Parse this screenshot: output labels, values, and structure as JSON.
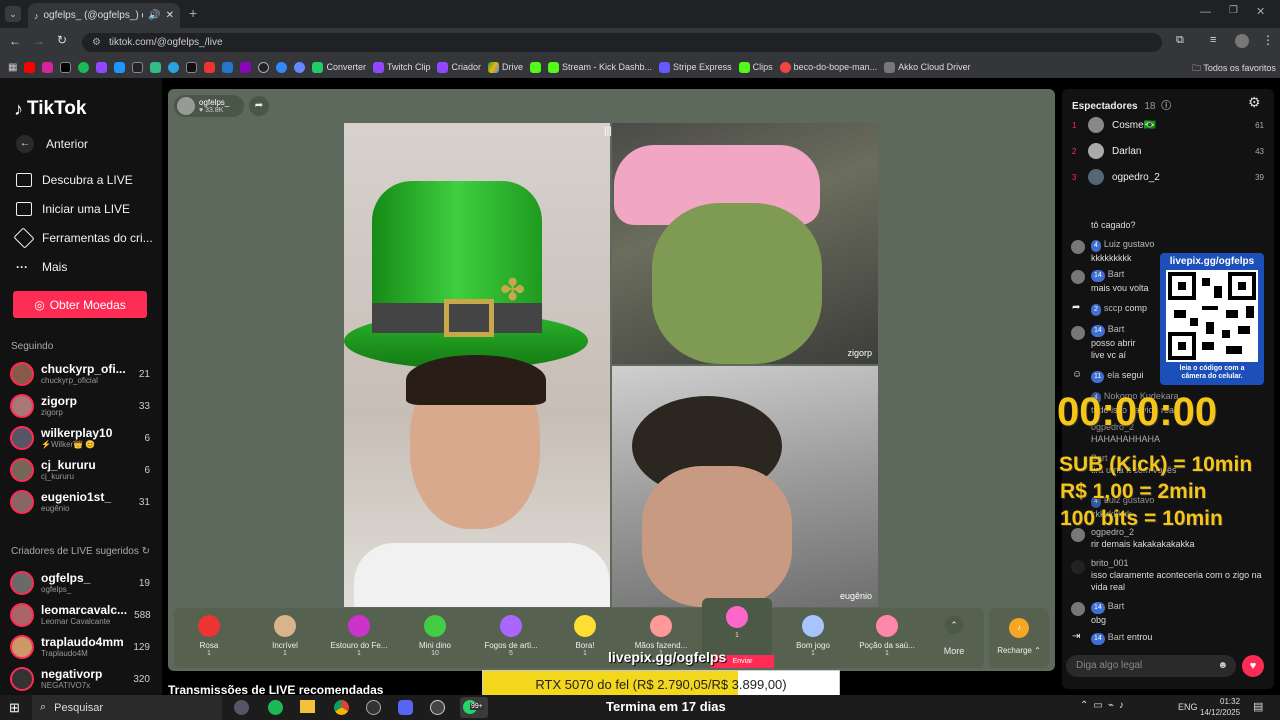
{
  "browser": {
    "tab_title": "ogfelps_ (@ogfelps_) come...",
    "url": "tiktok.com/@ogfelps_/live",
    "bookmarks": [
      "Converter",
      "Twitch Clip",
      "Criador",
      "Drive",
      "Stream - Kick Dashb...",
      "Stripe Express",
      "Clips",
      "beco-do-bope-man...",
      "Akko Cloud Driver"
    ],
    "all_favorites": "Todos os favoritos"
  },
  "sidebar": {
    "logo": "TikTok",
    "back": "Anterior",
    "nav": [
      "Descubra a LIVE",
      "Iniciar uma LIVE",
      "Ferramentas do cri...",
      "Mais"
    ],
    "coins_button": "Obter Moedas",
    "following_header": "Seguindo",
    "following": [
      {
        "name": "chuckyrp_ofi...",
        "sub": "chuckyrp_oficial",
        "count": "21"
      },
      {
        "name": "zigorp",
        "sub": "zigorp",
        "count": "33"
      },
      {
        "name": "wilkerplay10",
        "sub": "⚡Wilker👑 😊",
        "count": "6"
      },
      {
        "name": "cj_kururu",
        "sub": "cj_kururu",
        "count": "6"
      },
      {
        "name": "eugenio1st_",
        "sub": "eugênio",
        "count": "31"
      }
    ],
    "suggested_header": "Criadores de LIVE sugeridos",
    "suggested": [
      {
        "name": "ogfelps_",
        "sub": "ogfelps_",
        "count": "19"
      },
      {
        "name": "leomarcavalc...",
        "sub": "Leomar Cavalcante",
        "count": "588"
      },
      {
        "name": "traplaudo4mm",
        "sub": "Traplaudo4M",
        "count": "129"
      },
      {
        "name": "negativorp",
        "sub": "NEGATIVO7x",
        "count": "320"
      }
    ]
  },
  "stream": {
    "host": "ogfelps_",
    "likes": "33.8K",
    "guest1": "zigorp",
    "guest2": "eugênio",
    "recommended": "Transmissões de LIVE recomendadas"
  },
  "gifts": [
    {
      "name": "Rosa",
      "price": "1"
    },
    {
      "name": "Incrível",
      "price": "1"
    },
    {
      "name": "Estouro do Fe...",
      "price": "1"
    },
    {
      "name": "Mini dino",
      "price": "10"
    },
    {
      "name": "Fogos de arti...",
      "price": "5"
    },
    {
      "name": "Bora!",
      "price": "1"
    },
    {
      "name": "Mãos fazend...",
      "price": "1"
    },
    {
      "name": "",
      "price": "1"
    },
    {
      "name": "Bom jogo",
      "price": "1"
    },
    {
      "name": "Poção da saú...",
      "price": "1"
    }
  ],
  "gift_send": "Enviar",
  "more": "More",
  "recharge": "Recharge",
  "chat": {
    "viewers_title": "Espectadores",
    "viewers_count": "18",
    "top": [
      {
        "rank": "1",
        "name": "Cosme🇧🇷",
        "score": "61"
      },
      {
        "rank": "2",
        "name": "Darlan",
        "score": "43"
      },
      {
        "rank": "3",
        "name": "ogpedro_2",
        "score": "39"
      }
    ],
    "messages": [
      {
        "lvl": "",
        "user": "",
        "text": "tô cagado?"
      },
      {
        "lvl": "4",
        "user": "Luiz gustavo",
        "text": "kkkkkkkkk"
      },
      {
        "lvl": "14",
        "user": "Bart",
        "text": "mais vou volta"
      },
      {
        "lvl": "2",
        "user": "sccp",
        "text": "comp"
      },
      {
        "lvl": "14",
        "user": "Bart",
        "text": "posso abrir live vc aí"
      },
      {
        "lvl": "11",
        "user": "ela",
        "text": "segui"
      },
      {
        "lvl": "4",
        "user": "Nokomo Kudekara",
        "text": "tudo isso na vida real?"
      },
      {
        "lvl": "",
        "user": "ogpedro_2",
        "text": "HAHAHAHHAHA"
      },
      {
        "lvl": "",
        "user": "Bart",
        "text": "tira uma ft com vocês"
      },
      {
        "lvl": "4",
        "user": "Luiz gustavo",
        "text": "kkkkkkkkk"
      },
      {
        "lvl": "",
        "user": "ogpedro_2",
        "text": "rir demais kakakakakakka"
      },
      {
        "lvl": "",
        "user": "brito_001",
        "text": "isso claramente aconteceria com o zigo na vida real"
      },
      {
        "lvl": "14",
        "user": "Bart",
        "text": "obg"
      },
      {
        "lvl": "14",
        "user": "Bart",
        "text": "entrou"
      }
    ],
    "input_placeholder": "Diga algo legal"
  },
  "overlay": {
    "qr_title": "livepix.gg/ogfelps",
    "qr_caption": "leia o código com a câmera do celular.",
    "timer": "00:00:00",
    "line1": "SUB (Kick) = 10min",
    "line2": "R$ 1,00 = 2min",
    "line3": "100 bits = 10min",
    "livepix": "livepix.gg/ogfelps",
    "goal": "RTX 5070 do fel (R$ 2.790,05/R$ 3.899,00)",
    "goal_progress": 0.716,
    "ends": "Termina em 17 dias"
  },
  "taskbar": {
    "search": "Pesquisar",
    "lang": "ENG",
    "time": "01:32",
    "date": "14/12/2025",
    "badge": "99+"
  }
}
